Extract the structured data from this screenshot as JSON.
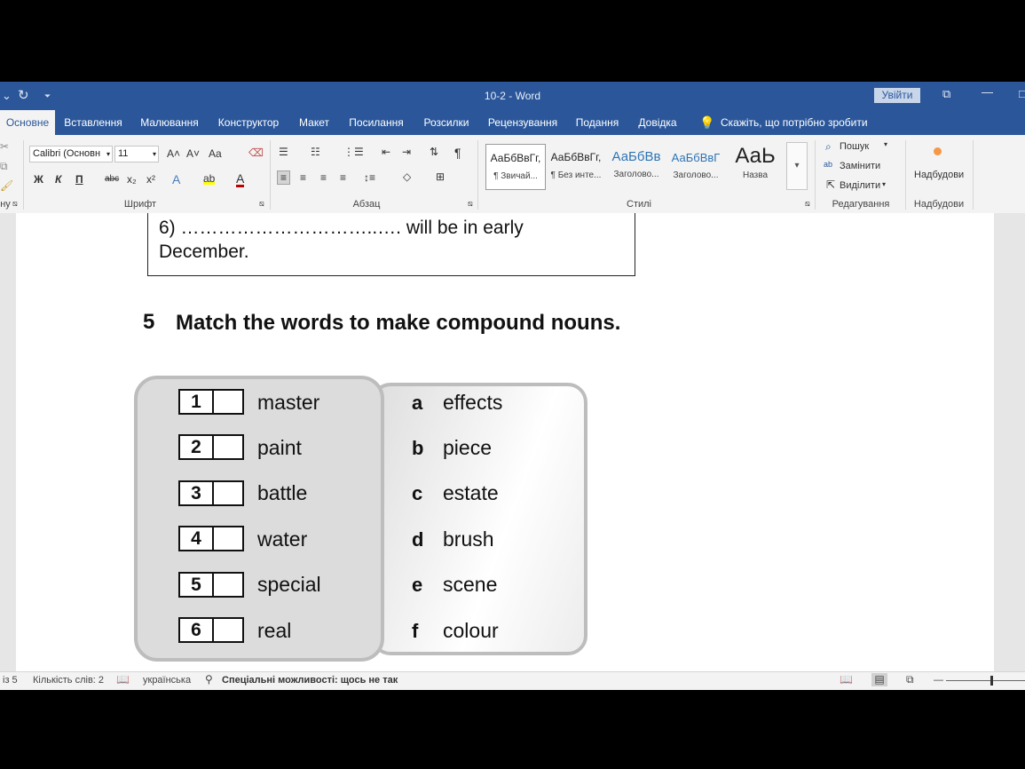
{
  "titlebar": {
    "document_title": "10-2  -  Word",
    "signin_label": "Увійти",
    "qa_undo": "⌄",
    "qa_redo": "↻",
    "qa_more": "⏷",
    "restore_icon": "⧉",
    "minimize_icon": "—",
    "maximize_icon": "□"
  },
  "tabs": [
    {
      "label": "Основне",
      "active": true
    },
    {
      "label": "Вставлення"
    },
    {
      "label": "Малювання"
    },
    {
      "label": "Конструктор"
    },
    {
      "label": "Макет"
    },
    {
      "label": "Посилання"
    },
    {
      "label": "Розсилки"
    },
    {
      "label": "Рецензування"
    },
    {
      "label": "Подання"
    },
    {
      "label": "Довідка"
    }
  ],
  "tellme": {
    "icon": "lightbulb-icon",
    "placeholder": "Скажіть, що потрібно зробити"
  },
  "ribbon": {
    "clipboard_label": "ну",
    "font": {
      "font_name": "Calibri (Основн",
      "font_size": "11",
      "group_label": "Шрифт",
      "grow": "A˄",
      "shrink": "A˅",
      "case": "Aa",
      "bold": "Ж",
      "italic": "К",
      "underline": "П",
      "strike": "abc",
      "subscript": "x₂",
      "superscript": "x²",
      "effects": "A",
      "highlight": "ab",
      "color": "A"
    },
    "paragraph": {
      "group_label": "Абзац",
      "pilcrow": "¶"
    },
    "styles": {
      "group_label": "Стилі",
      "items": [
        {
          "sample": "АаБбВвГг,",
          "name": "¶ Звичай..."
        },
        {
          "sample": "АаБбВвГг,",
          "name": "¶ Без инте..."
        },
        {
          "sample": "АаБбВв",
          "name": "Заголово..."
        },
        {
          "sample": "АаБбВвГ",
          "name": "Заголово..."
        },
        {
          "sample": "АаЬ",
          "name": "Назва"
        }
      ]
    },
    "editing": {
      "group_label": "Редагування",
      "find": "Пошук",
      "replace": "Замінити",
      "select": "Виділити"
    },
    "addins": {
      "button_label": "Надбудови",
      "group_label": "Надбудови"
    }
  },
  "document": {
    "prev_line": "6) …………………………..…. will be in early",
    "prev_line_cont": "December.",
    "question_number": "5",
    "question_text": "Match the words to make compound nouns.",
    "left_items": [
      {
        "num": "1",
        "word": "master"
      },
      {
        "num": "2",
        "word": "paint"
      },
      {
        "num": "3",
        "word": "battle"
      },
      {
        "num": "4",
        "word": "water"
      },
      {
        "num": "5",
        "word": "special"
      },
      {
        "num": "6",
        "word": "real"
      }
    ],
    "right_items": [
      {
        "letter": "a",
        "word": "effects"
      },
      {
        "letter": "b",
        "word": "piece"
      },
      {
        "letter": "c",
        "word": "estate"
      },
      {
        "letter": "d",
        "word": "brush"
      },
      {
        "letter": "e",
        "word": "scene"
      },
      {
        "letter": "f",
        "word": "colour"
      }
    ]
  },
  "statusbar": {
    "page": "із 5",
    "words": "Кількість слів: 2",
    "language": "українська",
    "accessibility": "Спеціальні можливості: щось не так",
    "zoom_out": "—"
  },
  "colors": {
    "accent": "#2b579a",
    "ribbon_bg": "#f3f3f3"
  }
}
